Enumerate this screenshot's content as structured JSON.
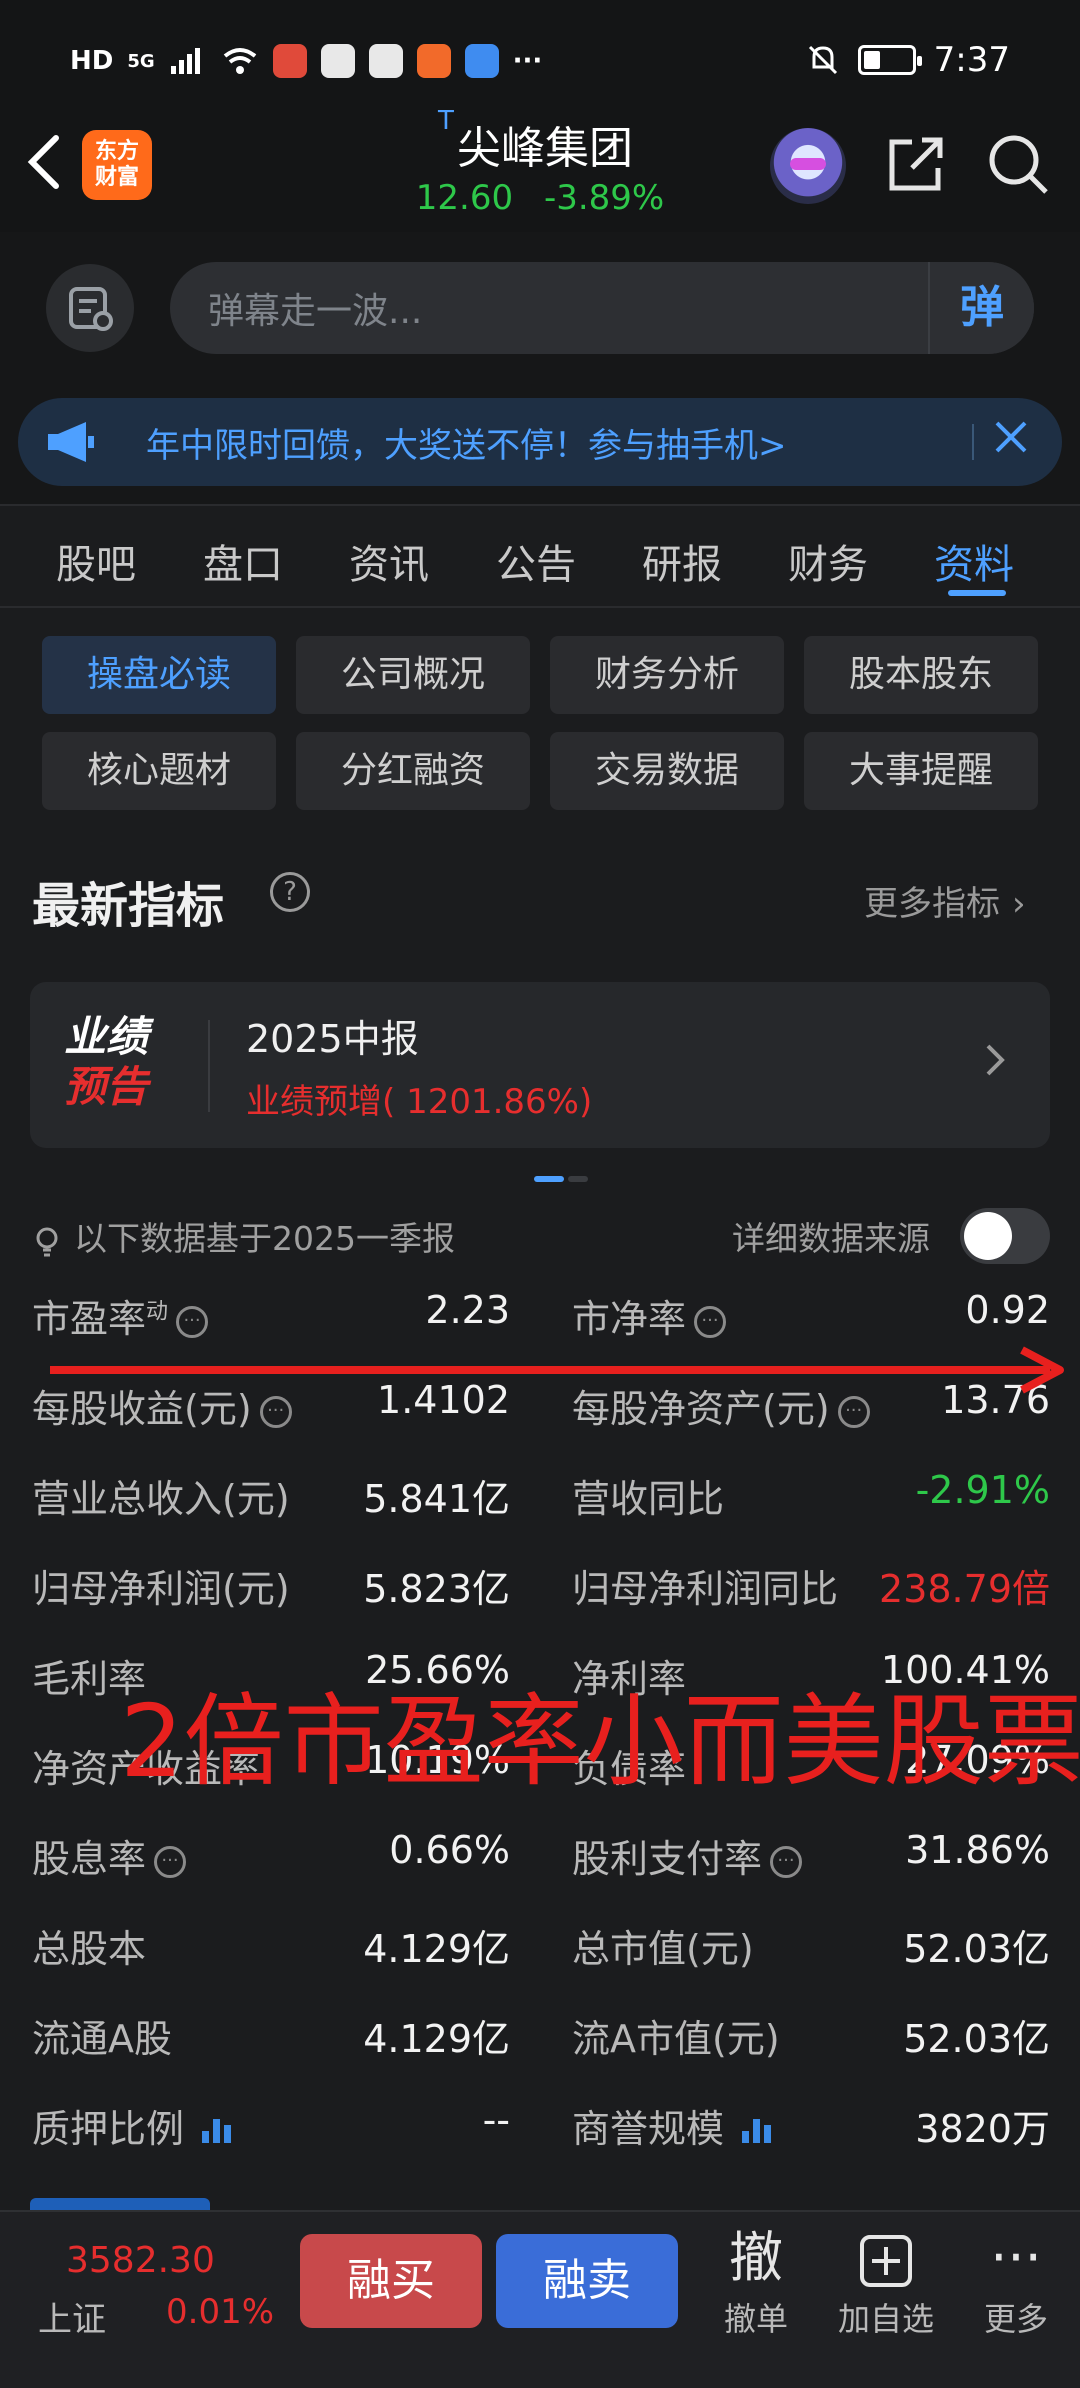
{
  "status_bar": {
    "left_badges": [
      "HD",
      "5G"
    ],
    "time": "7:37"
  },
  "header": {
    "brand_logo": "东方\n财富",
    "stock_tag": "T",
    "stock_name": "尖峰集团",
    "price": "12.60",
    "change_pct": "-3.89%"
  },
  "danmaku": {
    "placeholder": "弹幕走一波...",
    "send_label": "弹"
  },
  "promo": {
    "text": "年中限时回馈，大奖送不停！参与抽手机>"
  },
  "tabs": [
    "股吧",
    "盘口",
    "资讯",
    "公告",
    "研报",
    "财务",
    "资料"
  ],
  "active_tab": "资料",
  "subnav": [
    [
      "操盘必读",
      "公司概况",
      "财务分析",
      "股本股东"
    ],
    [
      "核心题材",
      "分红融资",
      "交易数据",
      "大事提醒"
    ]
  ],
  "indicators": {
    "title": "最新指标",
    "more": "更多指标",
    "card": {
      "badge_line1": "业绩",
      "badge_line2": "预告",
      "title": "2025中报",
      "subtitle": "业绩预增( 1201.86%)"
    },
    "basis": "以下数据基于2025一季报",
    "source_label": "详细数据来源",
    "rows": [
      {
        "l_label": "市盈率",
        "l_sup": "动",
        "l_info": true,
        "l_value": "2.23",
        "r_label": "市净率",
        "r_info": true,
        "r_value": "0.92",
        "r_color": ""
      },
      {
        "l_label": "每股收益(元)",
        "l_info": true,
        "l_value": "1.4102",
        "r_label": "每股净资产(元)",
        "r_info": true,
        "r_value": "13.76",
        "r_color": ""
      },
      {
        "l_label": "营业总收入(元)",
        "l_value": "5.841亿",
        "r_label": "营收同比",
        "r_value": "-2.91%",
        "r_color": "green"
      },
      {
        "l_label": "归母净利润(元)",
        "l_value": "5.823亿",
        "r_label": "归母净利润同比",
        "r_value": "238.79倍",
        "r_color": "red"
      },
      {
        "l_label": "毛利率",
        "l_value": "25.66%",
        "r_label": "净利率",
        "r_value": "100.41%",
        "r_color": ""
      },
      {
        "l_label": "净资产收益率",
        "l_value": "10.19%",
        "r_label": "负债率",
        "r_value": "27.09%",
        "r_color": ""
      },
      {
        "l_label": "股息率",
        "l_info": true,
        "l_value": "0.66%",
        "r_label": "股利支付率",
        "r_info": true,
        "r_value": "31.86%",
        "r_color": ""
      },
      {
        "l_label": "总股本",
        "l_value": "4.129亿",
        "r_label": "总市值(元)",
        "r_value": "52.03亿",
        "r_color": ""
      },
      {
        "l_label": "流通A股",
        "l_value": "4.129亿",
        "r_label": "流A市值(元)",
        "r_value": "52.03亿",
        "r_color": ""
      },
      {
        "l_label": "质押比例",
        "l_bars": true,
        "l_value": "--",
        "r_label": "商誉规模",
        "r_bars": true,
        "r_value": "3820万",
        "r_color": ""
      }
    ]
  },
  "overlay_text": "2倍市盈率小而美股票",
  "bottom_bar": {
    "index_value": "3582.30",
    "index_name": "上证",
    "index_change": "0.01%",
    "buy_label": "融买",
    "sell_label": "融卖",
    "tools": [
      {
        "glyph": "撤",
        "label": "撤单",
        "icon": "cancel-order-icon"
      },
      {
        "glyph": "+",
        "label": "加自选",
        "icon": "add-watchlist-icon"
      },
      {
        "glyph": "···",
        "label": "更多",
        "icon": "more-icon"
      }
    ]
  },
  "colors": {
    "accent_blue": "#4ea0ff",
    "up_red": "#e62e2e",
    "down_green": "#2ec84a",
    "annotation_red": "#e8201e"
  }
}
